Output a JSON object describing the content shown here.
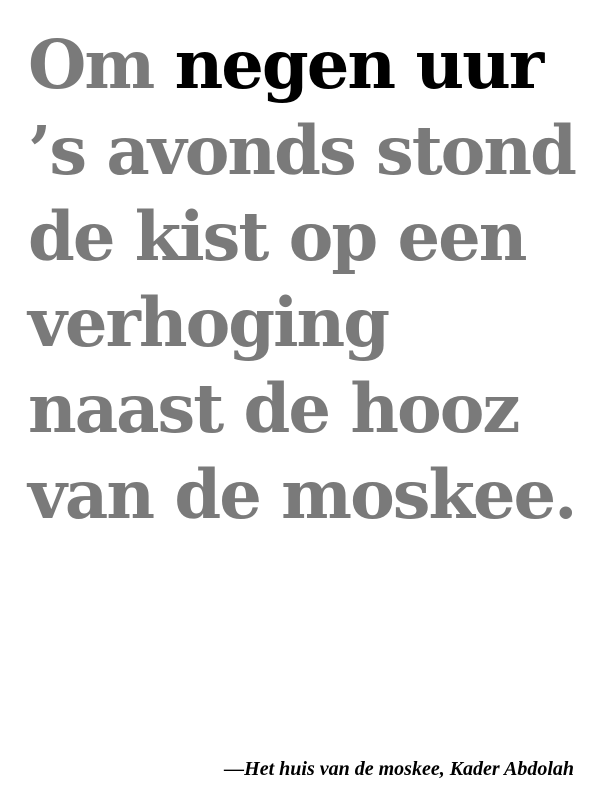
{
  "quote": {
    "lines": [
      {
        "plain": "Om ",
        "emphasis": "negen uur"
      },
      {
        "plain": "’s avonds stond"
      },
      {
        "plain": "de kist op een"
      },
      {
        "plain": "verhoging"
      },
      {
        "plain": "naast de hooz"
      },
      {
        "plain": "van de moskee."
      }
    ]
  },
  "attribution": "—Het huis van de moskee, Kader Abdolah",
  "colors": {
    "background": "#ffffff",
    "quote_text": "#7a7a7a",
    "emphasis_text": "#000000",
    "attribution_text": "#000000"
  }
}
